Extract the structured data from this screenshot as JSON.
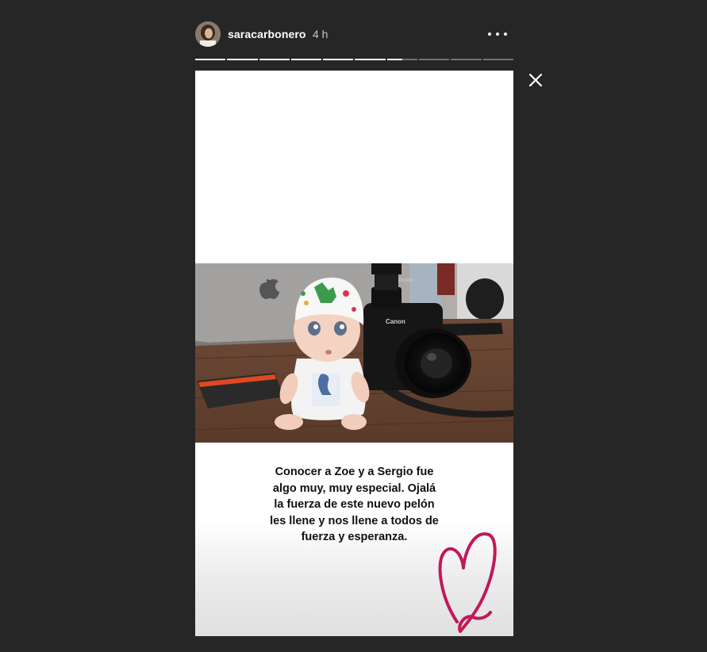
{
  "header": {
    "username": "saracarbonero",
    "time_ago": "4 h"
  },
  "progress": {
    "segment_count": 10,
    "current_segment": 7,
    "current_segment_fraction": 0.5
  },
  "story": {
    "caption_lines": [
      "Conocer a Zoe y a Sergio fue",
      "algo muy, muy especial. Ojalá",
      "la fuerza de este nuevo pelón",
      "les llene y nos llene a todos de",
      "fuerza y esperanza."
    ],
    "photo_labels": {
      "camera_brand": "Canon",
      "flash_brand": "Profoto"
    },
    "sticker": "heart-sticker"
  },
  "colors": {
    "background": "#262626",
    "heart": "#c2185b",
    "text": "#111111"
  },
  "icons": {
    "more": "more-options-icon",
    "close": "close-icon"
  }
}
